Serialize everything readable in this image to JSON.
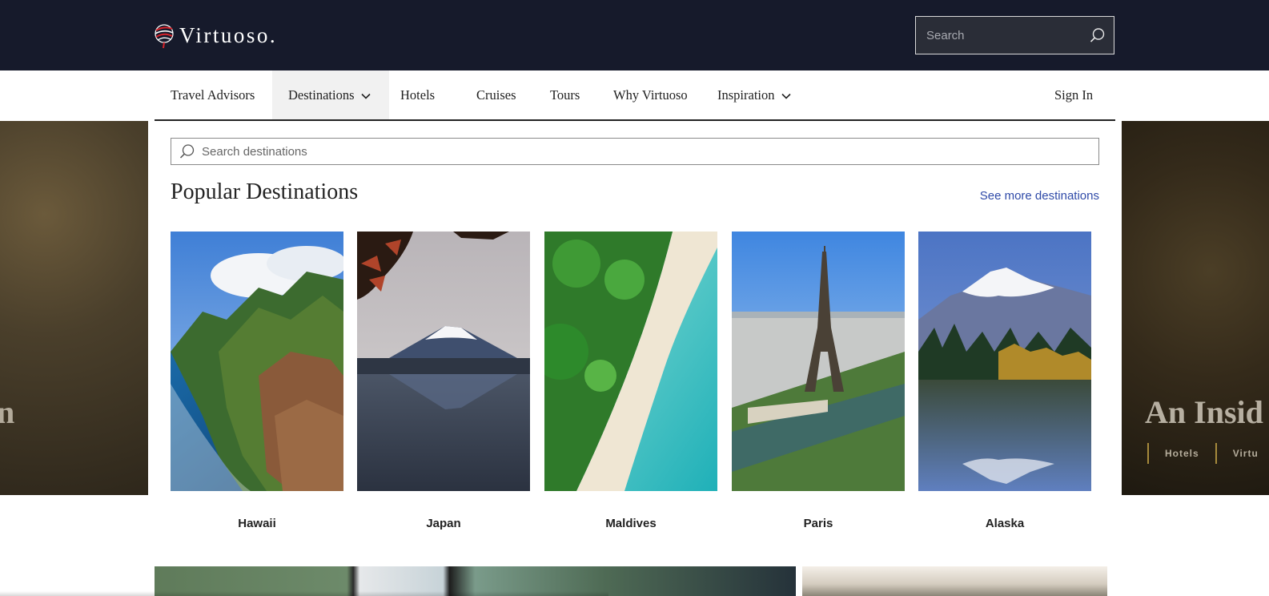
{
  "header": {
    "logo_text": "Virtuoso.",
    "search_placeholder": "Search"
  },
  "nav": {
    "items": [
      {
        "label": "Travel Advisors"
      },
      {
        "label": "Destinations",
        "has_dropdown": true,
        "active": true
      },
      {
        "label": "Hotels"
      },
      {
        "label": "Cruises"
      },
      {
        "label": "Tours"
      },
      {
        "label": "Why Virtuoso"
      },
      {
        "label": "Inspiration",
        "has_dropdown": true
      }
    ],
    "sign_in": "Sign In"
  },
  "hero": {
    "left_text": "n",
    "right_text": "An Insid",
    "right_tabs": [
      "Hotels",
      "Virtu"
    ]
  },
  "destinations_panel": {
    "search_placeholder": "Search destinations",
    "title": "Popular Destinations",
    "see_more": "See more destinations",
    "cards": [
      {
        "label": "Hawaii"
      },
      {
        "label": "Japan"
      },
      {
        "label": "Maldives"
      },
      {
        "label": "Paris"
      },
      {
        "label": "Alaska"
      }
    ]
  },
  "colors": {
    "header_bg": "#161a2b",
    "link": "#2f4aa8",
    "text": "#222222"
  }
}
